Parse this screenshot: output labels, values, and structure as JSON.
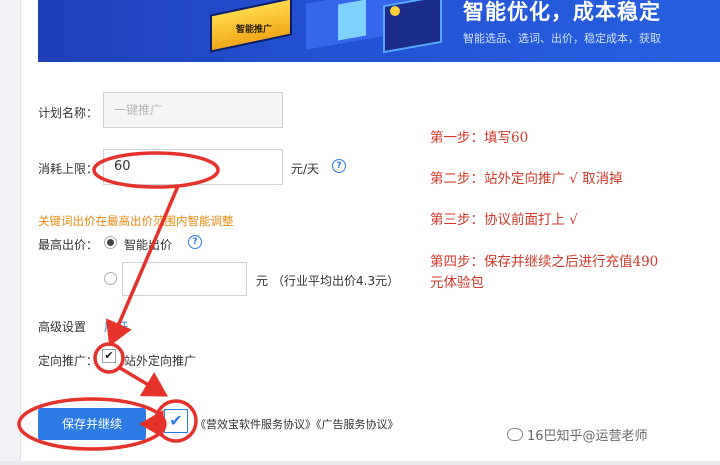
{
  "banner": {
    "tag_text": "智能推广",
    "title": "智能优化，成本稳定",
    "subtitle": "智能选品、选词、出价，稳定成本，获取"
  },
  "form": {
    "plan_name_label": "计划名称：",
    "plan_name_value": "一键推广",
    "budget_label": "消耗上限：",
    "budget_value": "60",
    "budget_unit": "元/天",
    "help_glyph": "?",
    "keyword_notice": "关键词出价在最高出价范围内智能调整",
    "max_bid_label": "最高出价：",
    "smart_bid_label": "智能出价",
    "custom_bid_unit": "元",
    "custom_bid_hint": "（行业平均出价4.3元）",
    "advanced_label": "高级设置",
    "expand_link": "展开",
    "targeting_label": "定向推广：",
    "offsite_label": "站外定向推广",
    "agreement_text": "《营效宝软件服务协议》《广告服务协议》",
    "save_button": "保存并继续"
  },
  "annotations": {
    "step1": "第一步：填写60",
    "step2": "第二步：站外定向推广 √ 取消掉",
    "step3": "第三步：协议前面打上 √",
    "step4_line1": "第四步：保存并继续之后进行充值490",
    "step4_line2": "元体验包",
    "color": "#d03a2d"
  },
  "watermark": "16巴知乎@运营老师",
  "state": {
    "smart_bid_selected": true,
    "offsite_targeting_checked": true,
    "agreement_checked": true
  },
  "colors": {
    "primary": "#2d7be5",
    "warning": "#e38b10",
    "banner": "#2452d4"
  }
}
